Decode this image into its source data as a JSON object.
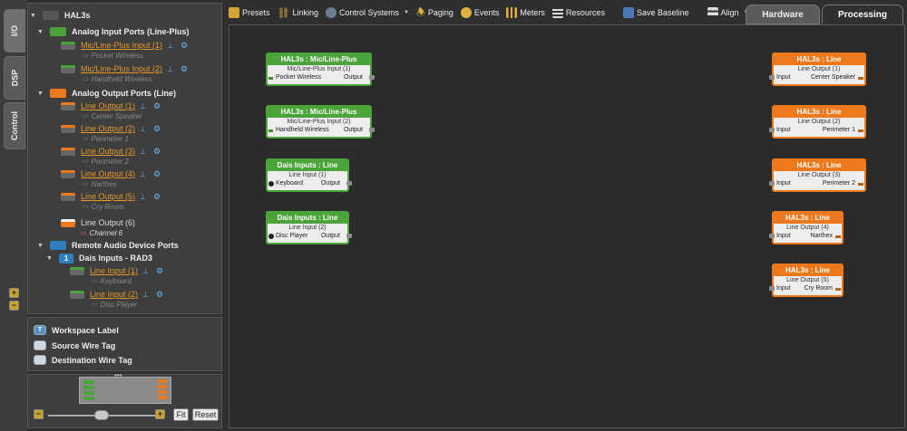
{
  "vertical_tabs": [
    "I/O",
    "DSP",
    "Control"
  ],
  "tree": {
    "root": "HAL3s",
    "groups": [
      {
        "label": "Analog Input Ports (Line-Plus)",
        "color": "#4aa43a"
      },
      {
        "label": "Analog Output Ports (Line)",
        "color": "#ec7a1c"
      },
      {
        "label": "Remote Audio Device Ports",
        "color": "#2f7fc0"
      }
    ],
    "inputs": [
      {
        "name": "Mic/Line-Plus Input (1)",
        "sub": "Pocket Wireless"
      },
      {
        "name": "Mic/Line-Plus Input (2)",
        "sub": "Handheld Wireless"
      }
    ],
    "outputs": [
      {
        "name": "Line Output (1)",
        "sub": "Center Speaker"
      },
      {
        "name": "Line Output (2)",
        "sub": "Perimeter 1"
      },
      {
        "name": "Line Output (3)",
        "sub": "Perimeter 2"
      },
      {
        "name": "Line Output (4)",
        "sub": "Narthex"
      },
      {
        "name": "Line Output (5)",
        "sub": "Cry Room"
      }
    ],
    "output6": {
      "name": "Line Output (6)",
      "sub": "Channel 6"
    },
    "rad": {
      "badge": "1",
      "name": "Dais Inputs - RAD3"
    },
    "rad_inputs": [
      {
        "name": "Line Input (1)",
        "sub": "Keyboard"
      },
      {
        "name": "Line Input (2)",
        "sub": "Disc Player"
      }
    ]
  },
  "legend": {
    "items": [
      "Workspace Label",
      "Source Wire Tag",
      "Destination Wire Tag"
    ]
  },
  "overview": {
    "fit_label": "Fit",
    "reset_label": "Reset",
    "zoom_level": 0.5
  },
  "toolbar": {
    "presets": "Presets",
    "linking": "Linking",
    "control_systems": "Control Systems",
    "paging": "Paging",
    "events": "Events",
    "meters": "Meters",
    "resources": "Resources",
    "save_baseline": "Save Baseline",
    "align": "Align"
  },
  "tabs": {
    "hardware": "Hardware",
    "processing": "Processing"
  },
  "canvas": {
    "input_nodes": [
      {
        "title": "HAL3s : Mic/Line-Plus",
        "subtitle": "Mic/Line-Plus Input (1)",
        "label": "Pocket Wireless",
        "port": "Output"
      },
      {
        "title": "HAL3s : Mic/Line-Plus",
        "subtitle": "Mic/Line-Plus Input (2)",
        "label": "Handheld Wireless",
        "port": "Output"
      },
      {
        "title": "Dais Inputs : Line",
        "subtitle": "Line Input (1)",
        "label": "Keyboard",
        "port": "Output"
      },
      {
        "title": "Dais Inputs : Line",
        "subtitle": "Line Input (2)",
        "label": "Disc Player",
        "port": "Output"
      }
    ],
    "output_nodes": [
      {
        "title": "HAL3s : Line",
        "subtitle": "Line Output (1)",
        "port": "Input",
        "label": "Center Speaker"
      },
      {
        "title": "HAL3s : Line",
        "subtitle": "Line Output (2)",
        "port": "Input",
        "label": "Perimeter 1"
      },
      {
        "title": "HAL3s : Line",
        "subtitle": "Line Output (3)",
        "port": "Input",
        "label": "Perimeter 2"
      },
      {
        "title": "HAL3s : Line",
        "subtitle": "Line Output (4)",
        "port": "Input",
        "label": "Narthex"
      },
      {
        "title": "HAL3s : Line",
        "subtitle": "Line Output (5)",
        "port": "Input",
        "label": "Cry Room"
      }
    ]
  },
  "colors": {
    "input": "#4aa43a",
    "output": "#ec7a1c",
    "remote": "#2f7fc0",
    "link": "#e39a2b"
  }
}
